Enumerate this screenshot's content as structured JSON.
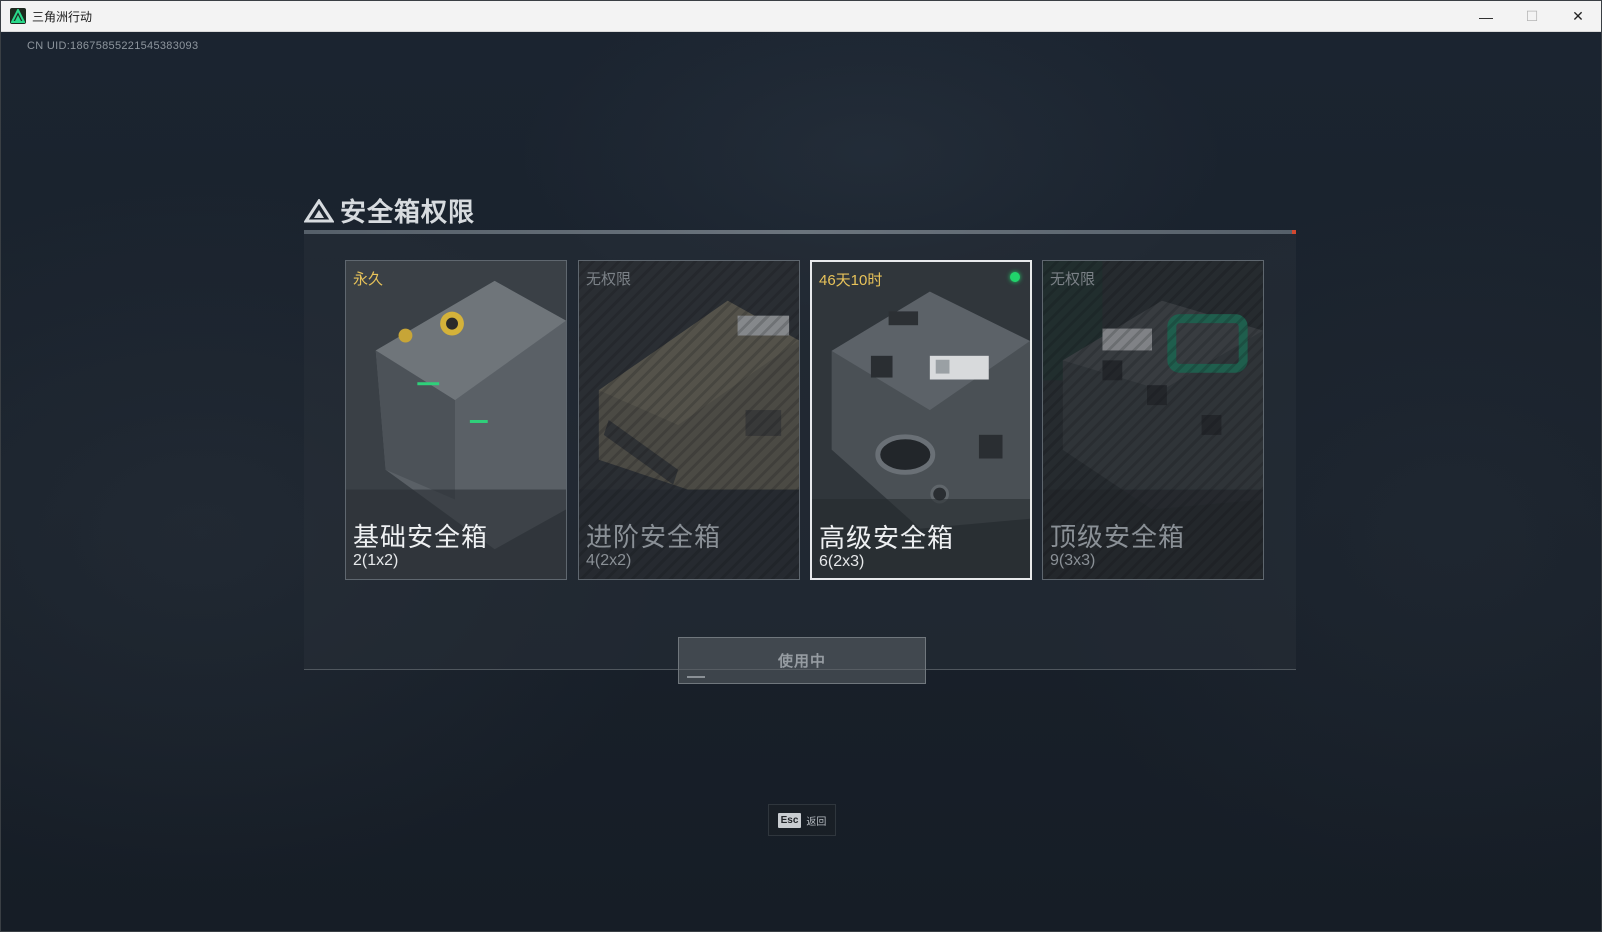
{
  "window": {
    "title": "三角洲行动",
    "controls": {
      "minimize": "—",
      "maximize": "☐",
      "close": "✕"
    }
  },
  "uid": "CN UID:18675855221545383093",
  "dialog": {
    "title": "安全箱权限",
    "cards": [
      {
        "name": "基础安全箱",
        "capacity": "2(1x2)",
        "status": "永久",
        "state": "owned"
      },
      {
        "name": "进阶安全箱",
        "capacity": "4(2x2)",
        "status": "无权限",
        "state": "locked"
      },
      {
        "name": "高级安全箱",
        "capacity": "6(2x3)",
        "status": "46天10时",
        "state": "selected-in-use"
      },
      {
        "name": "顶级安全箱",
        "capacity": "9(3x3)",
        "status": "无权限",
        "state": "locked"
      }
    ],
    "action_button": "使用中"
  },
  "footer": {
    "key": "Esc",
    "label": "返回"
  },
  "colors": {
    "accent_gold": "#e8c35a",
    "active_dot": "#21d36b"
  }
}
